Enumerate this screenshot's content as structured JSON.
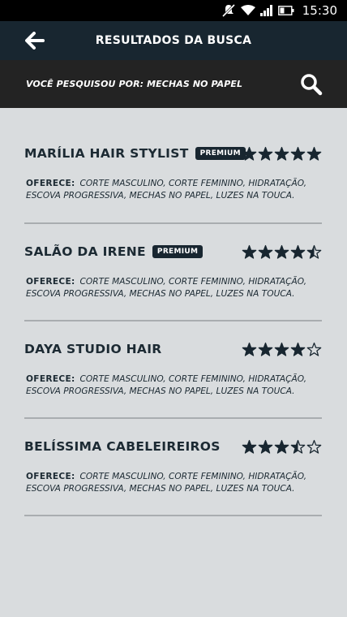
{
  "status_bar": {
    "time": "15:30",
    "icons": [
      "notifications-off-icon",
      "wifi-icon",
      "signal-icon",
      "battery-icon"
    ]
  },
  "header": {
    "back_icon": "arrow-left-icon",
    "title": "RESULTADOS DA BUSCA"
  },
  "search": {
    "query_text": "VOCÊ PESQUISOU POR: MECHAS NO PAPEL",
    "icon": "search-icon"
  },
  "colors": {
    "header_bg": "#182630",
    "search_bg": "#232323",
    "page_bg": "#d9dcde",
    "accent": "#182630"
  },
  "results": [
    {
      "name": "MARÍLIA HAIR STYLIST",
      "badge": "PREMIUM",
      "rating": 5,
      "offers_label": "OFERECE:",
      "offers_text": "CORTE MASCULINO, CORTE FEMININO, HIDRATAÇÃO, ESCOVA PROGRESSIVA, MECHAS NO PAPEL, LUZES NA TOUCA."
    },
    {
      "name": "SALÃO DA IRENE",
      "badge": "PREMIUM",
      "rating": 4.5,
      "offers_label": "OFERECE:",
      "offers_text": "CORTE MASCULINO, CORTE FEMININO, HIDRATAÇÃO, ESCOVA PROGRESSIVA, MECHAS NO PAPEL, LUZES NA TOUCA."
    },
    {
      "name": "DAYA STUDIO HAIR",
      "badge": "",
      "rating": 4,
      "offers_label": "OFERECE:",
      "offers_text": "CORTE MASCULINO, CORTE FEMININO, HIDRATAÇÃO, ESCOVA PROGRESSIVA, MECHAS NO PAPEL, LUZES NA TOUCA."
    },
    {
      "name": "BELÍSSIMA CABELEIREIROS",
      "badge": "",
      "rating": 3.5,
      "offers_label": "OFERECE:",
      "offers_text": "CORTE MASCULINO, CORTE FEMININO, HIDRATAÇÃO, ESCOVA PROGRESSIVA, MECHAS NO PAPEL, LUZES NA TOUCA."
    }
  ]
}
